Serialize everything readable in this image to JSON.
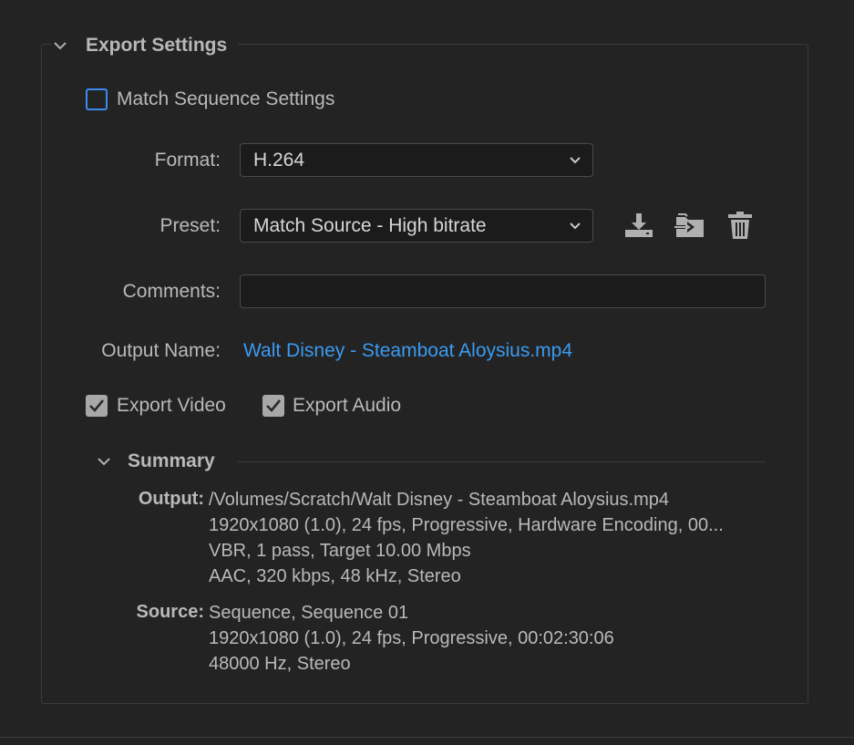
{
  "section": {
    "title": "Export Settings"
  },
  "match_sequence": {
    "label": "Match Sequence Settings",
    "checked": false
  },
  "format": {
    "label": "Format:",
    "value": "H.264"
  },
  "preset": {
    "label": "Preset:",
    "value": "Match Source - High bitrate"
  },
  "preset_actions": [
    "download-icon",
    "import-icon",
    "trash-icon"
  ],
  "comments": {
    "label": "Comments:",
    "value": ""
  },
  "output_name": {
    "label": "Output Name:",
    "value": "Walt Disney - Steamboat Aloysius.mp4"
  },
  "export_video": {
    "label": "Export Video",
    "checked": true
  },
  "export_audio": {
    "label": "Export Audio",
    "checked": true
  },
  "summary": {
    "title": "Summary",
    "output": {
      "key": "Output:",
      "lines": [
        "/Volumes/Scratch/Walt Disney - Steamboat Aloysius.mp4",
        "1920x1080 (1.0), 24 fps, Progressive, Hardware Encoding, 00...",
        "VBR, 1 pass, Target 10.00 Mbps",
        "AAC, 320 kbps, 48 kHz, Stereo"
      ]
    },
    "source": {
      "key": "Source:",
      "lines": [
        "Sequence, Sequence 01",
        "1920x1080 (1.0), 24 fps, Progressive, 00:02:30:06",
        "48000 Hz, Stereo"
      ]
    }
  },
  "colors": {
    "accent": "#3b9af0",
    "background": "#232323",
    "field": "#1b1b1b"
  }
}
